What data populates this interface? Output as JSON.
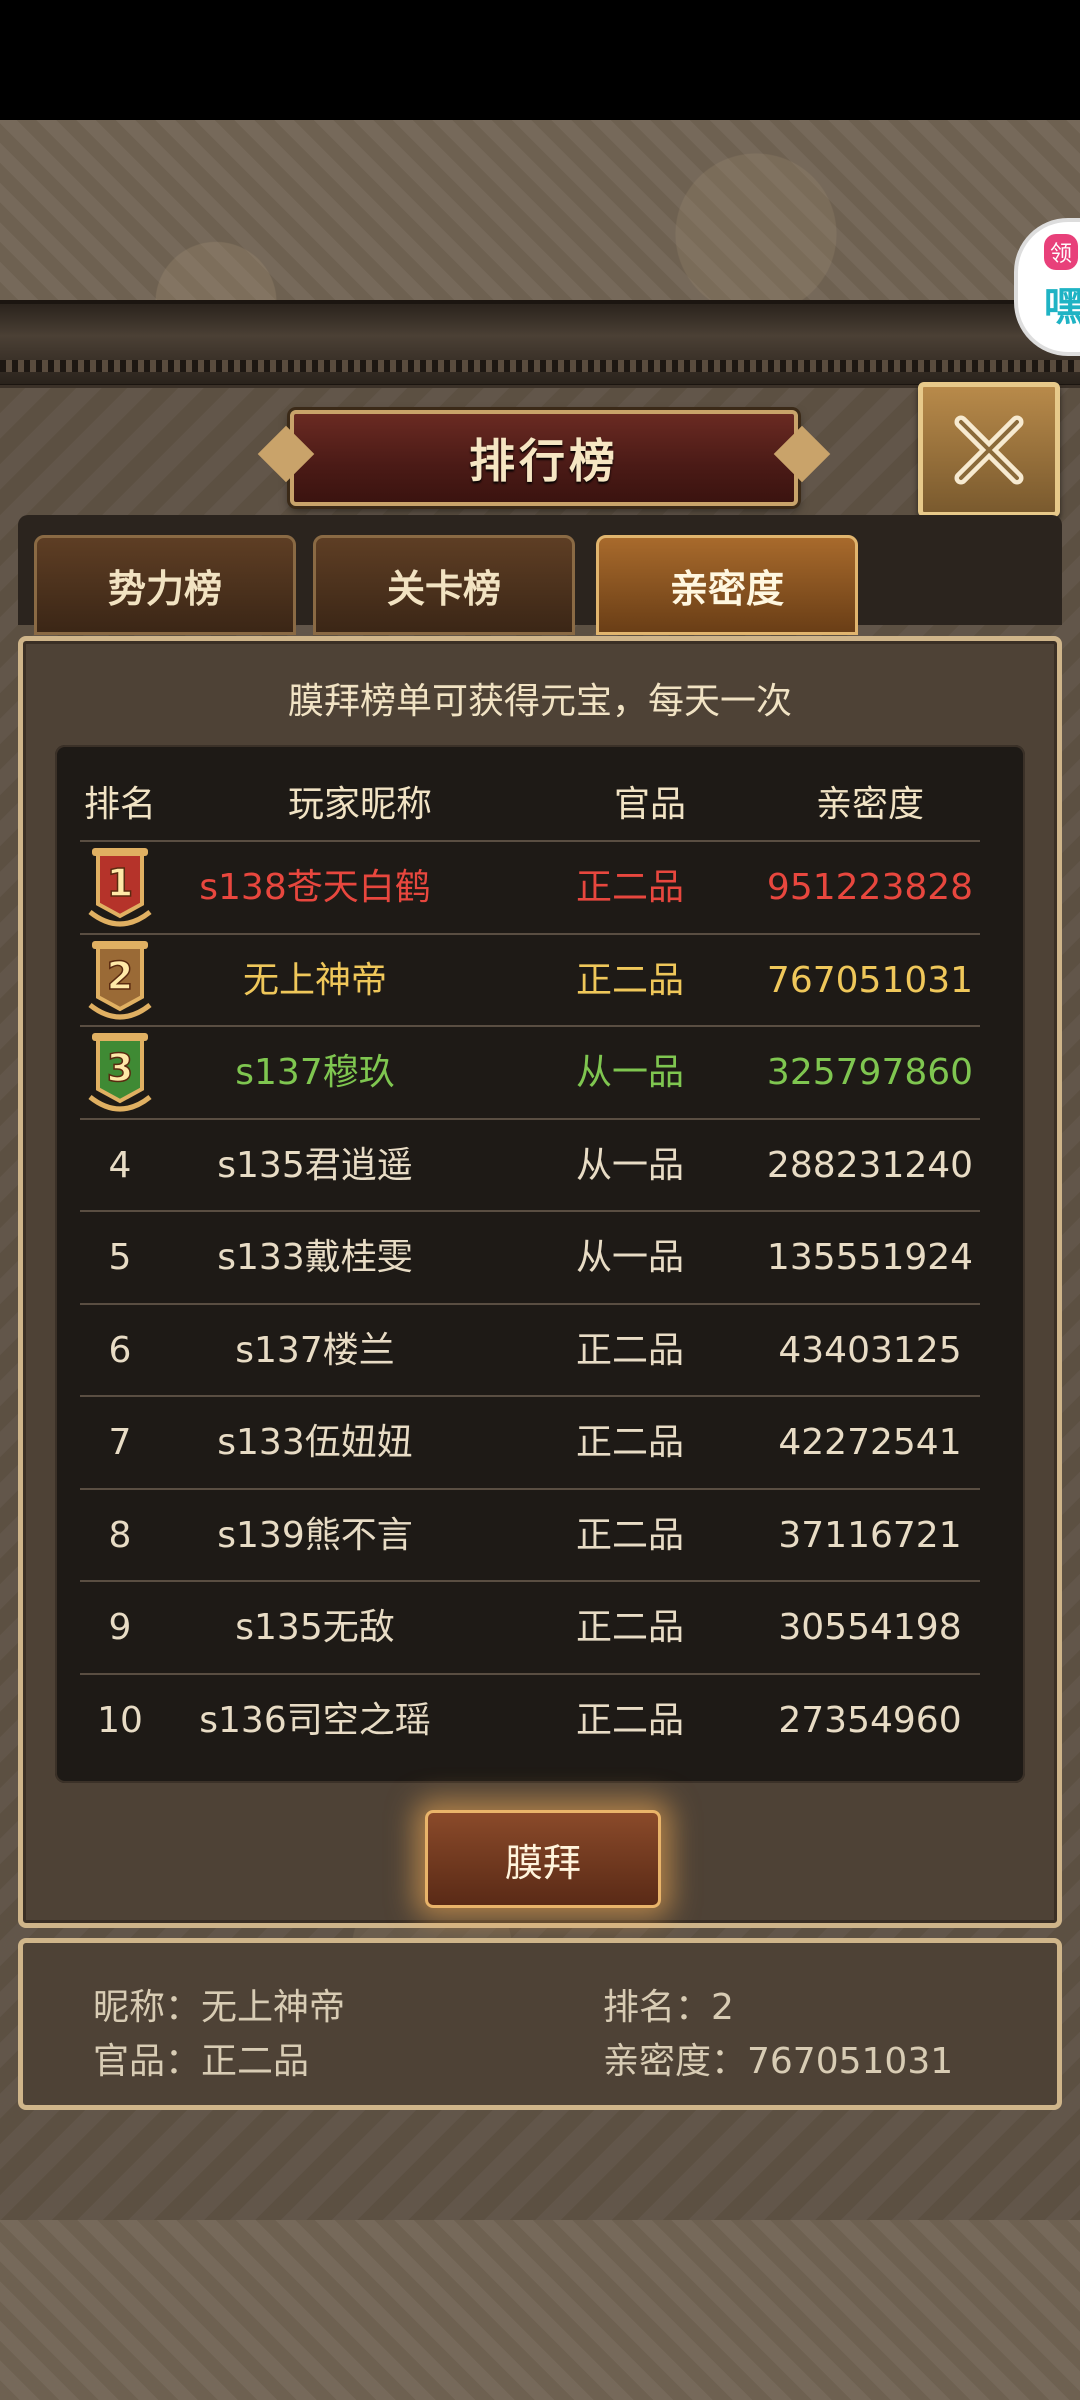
{
  "side_widget": {
    "badge": "领",
    "glyph": "嘿"
  },
  "title": "排行榜",
  "tabs": [
    {
      "label": "势力榜",
      "active": false
    },
    {
      "label": "关卡榜",
      "active": false
    },
    {
      "label": "亲密度",
      "active": true
    }
  ],
  "notice": "膜拜榜单可获得元宝，每天一次",
  "table": {
    "headers": {
      "rank": "排名",
      "name": "玩家昵称",
      "rank_title": "官品",
      "intimacy": "亲密度"
    },
    "rows": [
      {
        "rank": "1",
        "name": "s138苍天白鹤",
        "rank_title": "正二品",
        "intimacy": "951223828"
      },
      {
        "rank": "2",
        "name": "无上神帝",
        "rank_title": "正二品",
        "intimacy": "767051031"
      },
      {
        "rank": "3",
        "name": "s137穆玖",
        "rank_title": "从一品",
        "intimacy": "325797860"
      },
      {
        "rank": "4",
        "name": "s135君逍遥",
        "rank_title": "从一品",
        "intimacy": "288231240"
      },
      {
        "rank": "5",
        "name": "s133戴桂雯",
        "rank_title": "从一品",
        "intimacy": "135551924"
      },
      {
        "rank": "6",
        "name": "s137楼兰",
        "rank_title": "正二品",
        "intimacy": "43403125"
      },
      {
        "rank": "7",
        "name": "s133伍妞妞",
        "rank_title": "正二品",
        "intimacy": "42272541"
      },
      {
        "rank": "8",
        "name": "s139熊不言",
        "rank_title": "正二品",
        "intimacy": "37116721"
      },
      {
        "rank": "9",
        "name": "s135无敌",
        "rank_title": "正二品",
        "intimacy": "30554198"
      },
      {
        "rank": "10",
        "name": "s136司空之瑶",
        "rank_title": "正二品",
        "intimacy": "27354960"
      }
    ]
  },
  "worship_button": "膜拜",
  "my_info": {
    "nickname": "昵称：无上神帝",
    "rank": "排名：2",
    "rank_title": "官品：正二品",
    "intimacy": "亲密度：767051031"
  },
  "colors": {
    "first": "#e8473e",
    "second": "#efc75a",
    "third": "#7fc650",
    "normal": "#e8dcc5"
  }
}
